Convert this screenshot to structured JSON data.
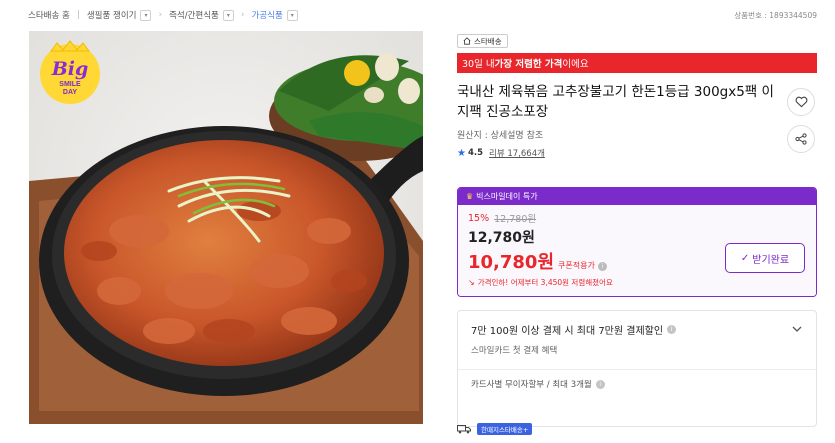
{
  "breadcrumb": [
    {
      "label": "스타배송 홈"
    },
    {
      "label": "생필품 쟁이기"
    },
    {
      "label": "즉석/간편식품"
    },
    {
      "label": "가공식품"
    }
  ],
  "product_number": "상품번호 : 1893344509",
  "badge": {
    "line1": "Big",
    "line2": "SMILE",
    "line3": "DAY"
  },
  "store_tag": "스타배송",
  "promo": {
    "prefix": "30일 내 ",
    "highlight": "가장 저렴한 가격",
    "suffix": "이에요"
  },
  "title": "국내산 제육볶음 고추장불고기 한돈1등급 300gx5팩 이지팩 진공소포장",
  "origin": "원산지 : 상세설명 참조",
  "rating": {
    "score": "4.5",
    "reviews": "리뷰 17,664개"
  },
  "deal": {
    "header": "빅스마일데이 특가",
    "discount": "15%",
    "original_price": "12,780원",
    "price": "12,780원",
    "coupon_price": "10,780원",
    "coupon_label": "쿠폰적용가",
    "price_drop_note": "가격인하! 어제부터 3,450원 저렴해졌어요",
    "coupon_button": "받기완료"
  },
  "benefit": {
    "title": "7만 100원 이상 결제 시 최대 7만원 결제할인",
    "subtitle": "스마일카드 첫 결제 혜택",
    "installment": "카드사별 무이자할부 / 최대 3개월"
  },
  "shipping_tag": "한때지스타배송+",
  "colors": {
    "accent_purple": "#7a2bc9",
    "red": "#e8262b",
    "blue": "#2a6ee8"
  }
}
